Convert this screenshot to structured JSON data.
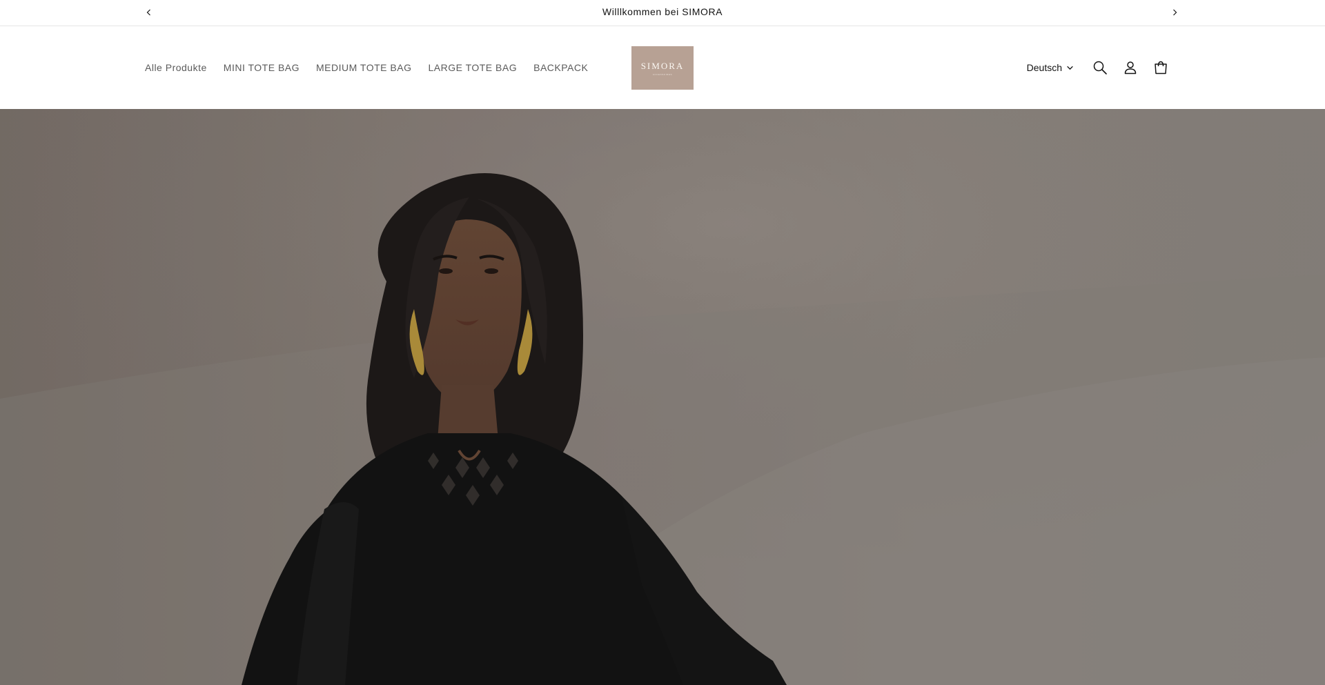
{
  "announcement": {
    "text": "Willlkommen bei SIMORA",
    "prev_icon": "chevron-left-icon",
    "next_icon": "chevron-right-icon"
  },
  "nav": {
    "items": [
      {
        "label": "Alle Produkte"
      },
      {
        "label": "MINI TOTE BAG"
      },
      {
        "label": "MEDIUM TOTE BAG"
      },
      {
        "label": "LARGE TOTE BAG"
      },
      {
        "label": "BACKPACK"
      }
    ]
  },
  "logo": {
    "text": "SIMORA",
    "subtext": "ACCESSOIRES",
    "background": "#b7a194"
  },
  "header_tools": {
    "language": "Deutsch",
    "icons": [
      "search-icon",
      "account-icon",
      "cart-icon"
    ]
  },
  "hero": {
    "image_alt": "model-in-black-embroidered-dress",
    "overlay_color": "#000000"
  }
}
